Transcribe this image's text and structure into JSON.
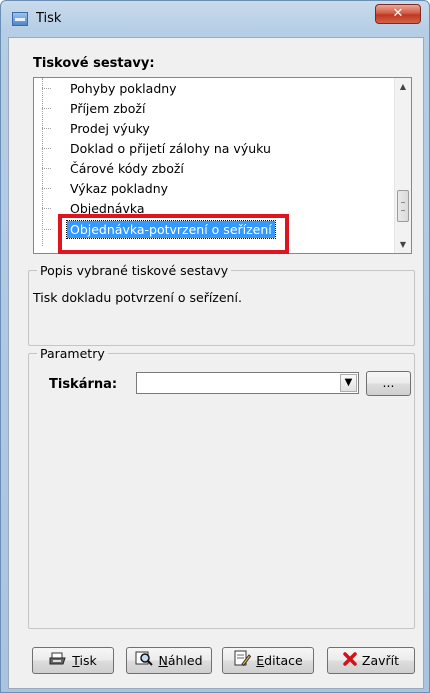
{
  "window": {
    "title": "Tisk",
    "close_glyph": "✕"
  },
  "report_list": {
    "label": "Tiskové sestavy:",
    "items": [
      {
        "label": "Pohyby pokladny"
      },
      {
        "label": "Příjem zboží"
      },
      {
        "label": "Prodej výuky"
      },
      {
        "label": "Doklad o přijetí zálohy na výuku"
      },
      {
        "label": "Čárové kódy zboží"
      },
      {
        "label": "Výkaz pokladny"
      },
      {
        "label": "Objednávka"
      },
      {
        "label": "Objednávka-potvrzení o seřízení",
        "selected": true
      }
    ],
    "highlight_color": "#e0141e",
    "selection_color": "#3399ff"
  },
  "description": {
    "title": "Popis vybrané tiskové sestavy",
    "text": "Tisk dokladu potvrzení o seřízení."
  },
  "parameters": {
    "title": "Parametry",
    "printer_label": "Tiskárna:",
    "printer_value": "",
    "browse_label": "..."
  },
  "buttons": {
    "print": {
      "accel": "T",
      "rest": "isk",
      "icon": "printer-icon"
    },
    "preview": {
      "accel": "N",
      "rest": "áhled",
      "icon": "preview-icon"
    },
    "edit": {
      "accel": "E",
      "rest": "ditace",
      "icon": "edit-icon"
    },
    "close": {
      "label": "Zavřít",
      "icon": "red-x-icon"
    }
  }
}
